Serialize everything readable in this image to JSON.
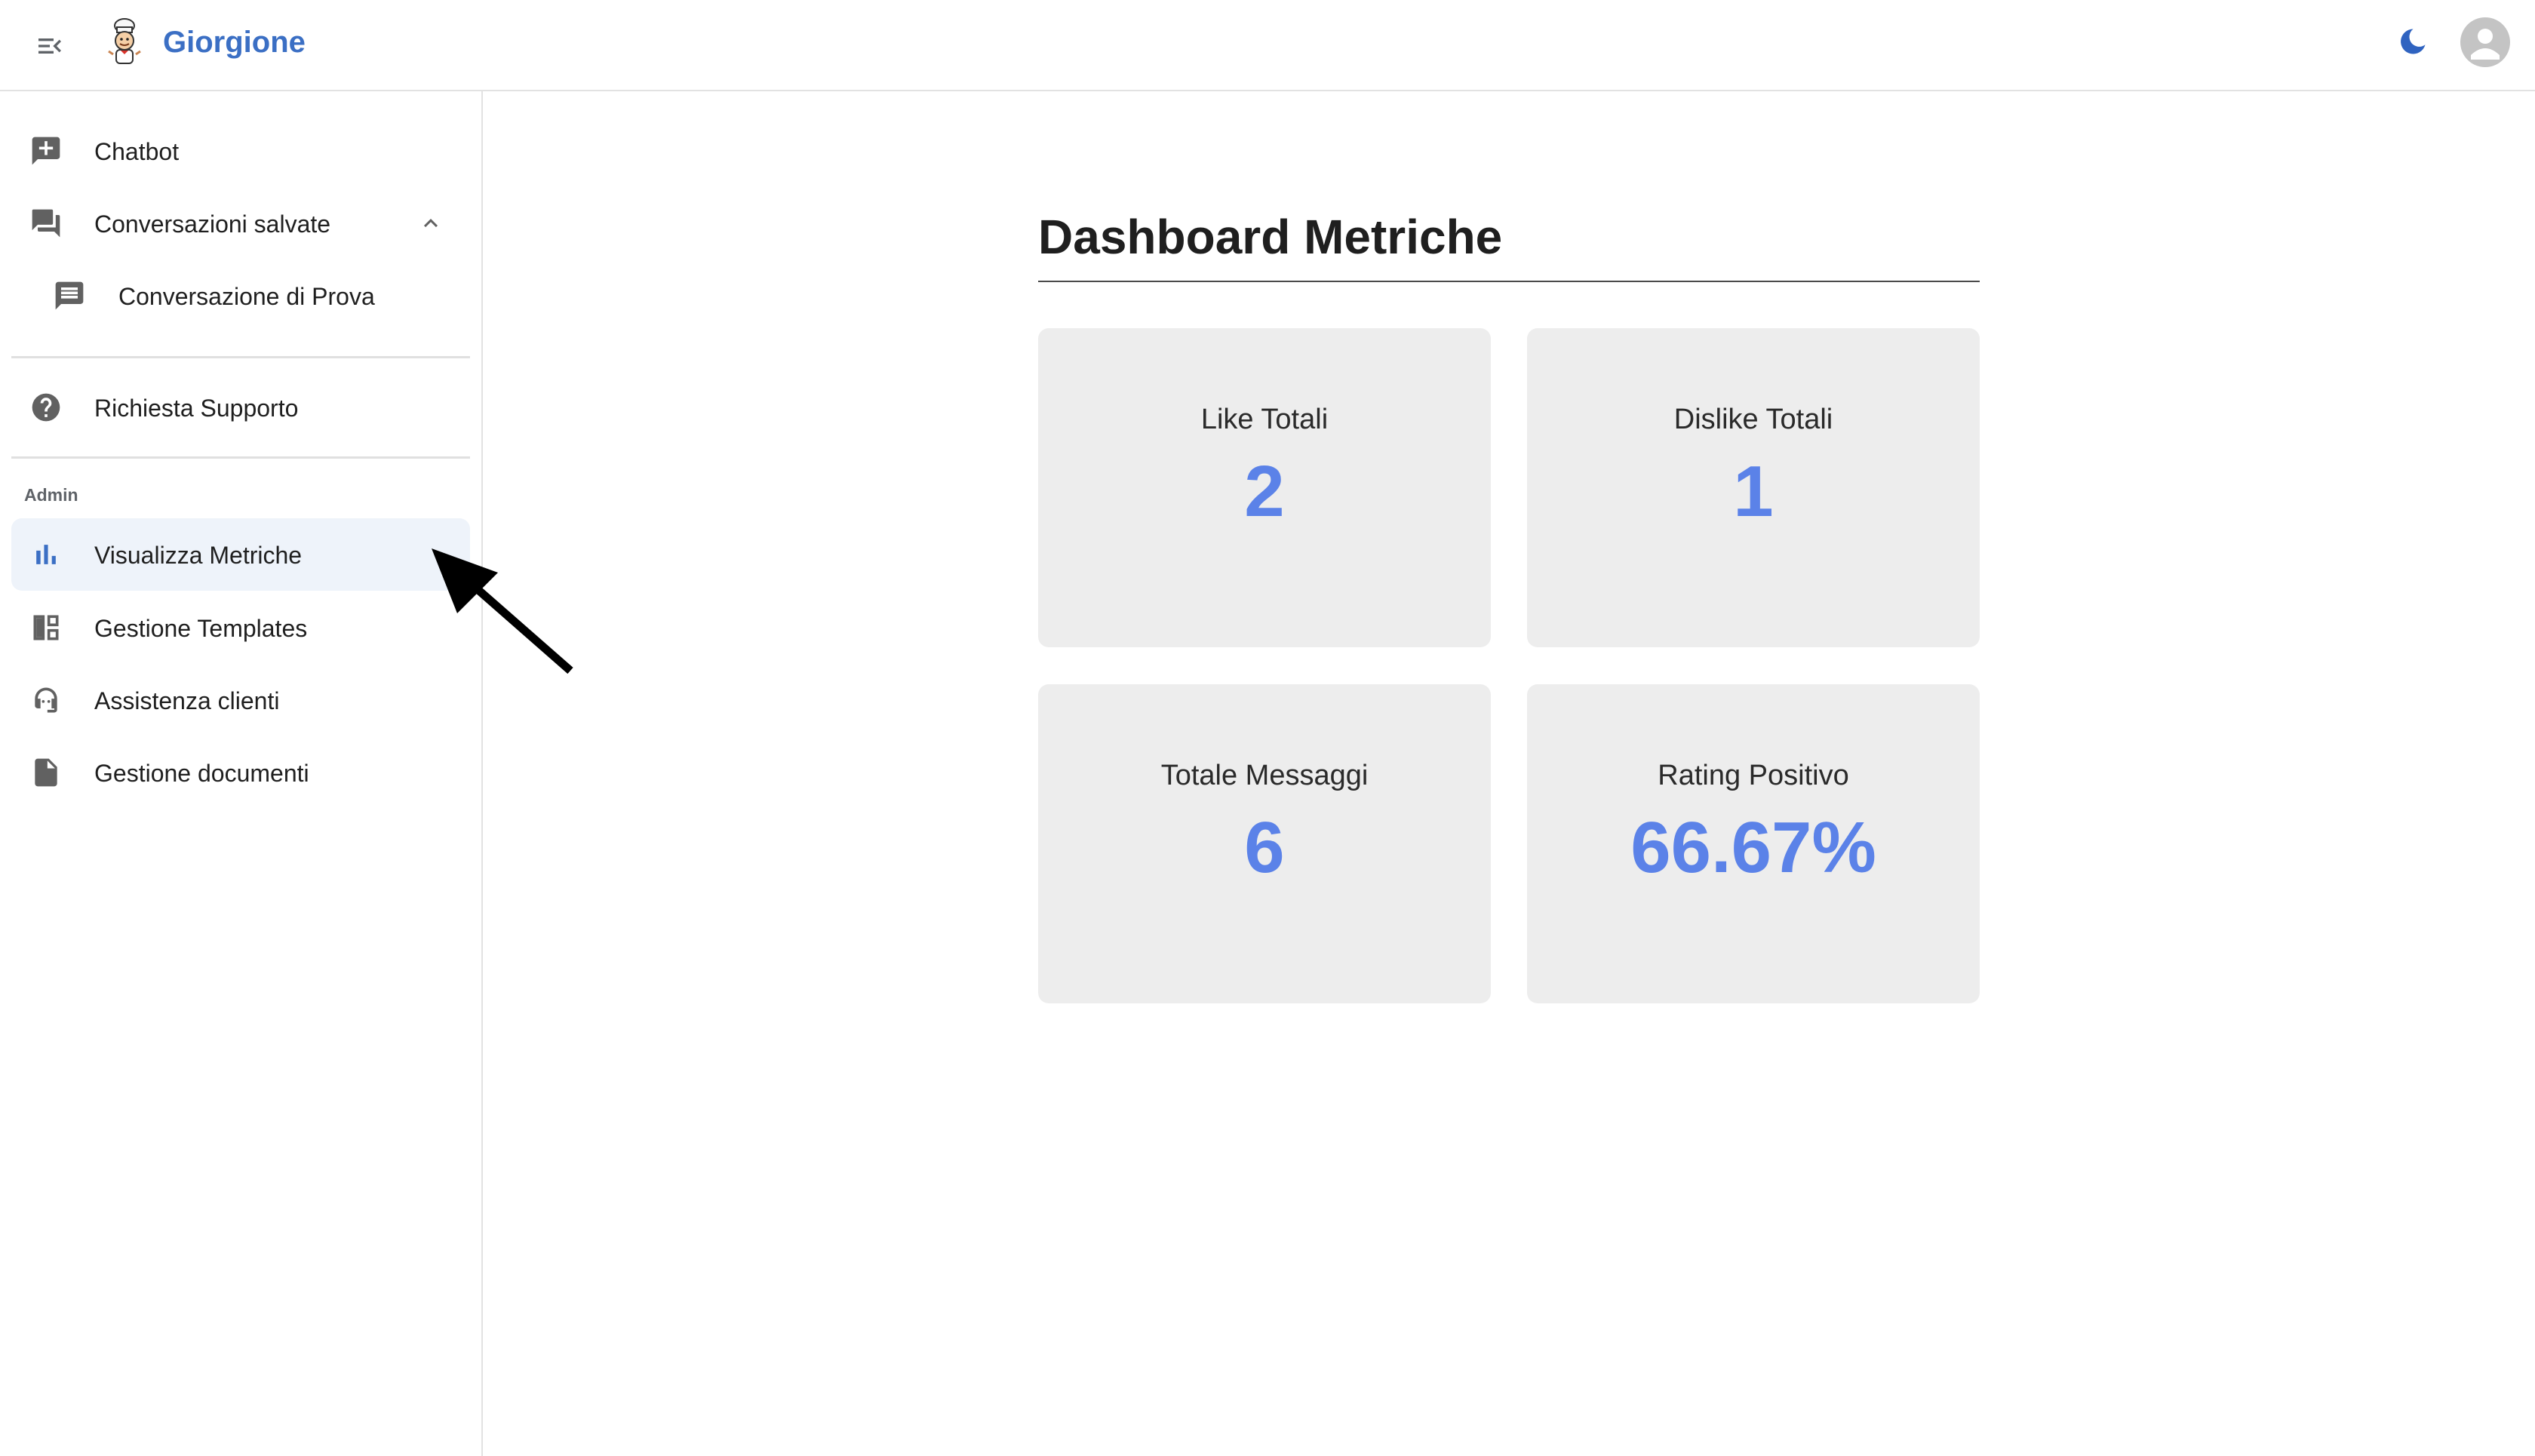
{
  "app": {
    "brand": "Giorgione",
    "logo_icon": "chef-mascot-logo",
    "menu_icon": "menu-collapse-icon",
    "theme_icon": "moon-icon",
    "avatar_icon": "account-circle-icon",
    "accent_color": "#3b6fc4"
  },
  "sidebar": {
    "items": [
      {
        "label": "Chatbot",
        "icon": "chat-add-icon"
      },
      {
        "label": "Conversazioni salvate",
        "icon": "forum-icon",
        "expanded": true
      },
      {
        "label": "Conversazione di Prova",
        "icon": "message-icon"
      },
      {
        "label": "Richiesta Supporto",
        "icon": "help-circle-icon"
      }
    ],
    "admin_section_label": "Admin",
    "admin_items": [
      {
        "label": "Visualizza Metriche",
        "icon": "bar-chart-icon",
        "active": true
      },
      {
        "label": "Gestione Templates",
        "icon": "dashboard-layout-icon"
      },
      {
        "label": "Assistenza clienti",
        "icon": "support-agent-icon"
      },
      {
        "label": "Gestione documenti",
        "icon": "document-icon"
      }
    ],
    "active_color": "#eef3fa"
  },
  "main": {
    "title": "Dashboard Metriche",
    "cards": [
      {
        "label": "Like Totali",
        "value": "2"
      },
      {
        "label": "Dislike Totali",
        "value": "1"
      },
      {
        "label": "Totale Messaggi",
        "value": "6"
      },
      {
        "label": "Rating Positivo",
        "value": "66.67%"
      }
    ],
    "card_background": "#ededed",
    "value_color": "#5b82e8"
  }
}
